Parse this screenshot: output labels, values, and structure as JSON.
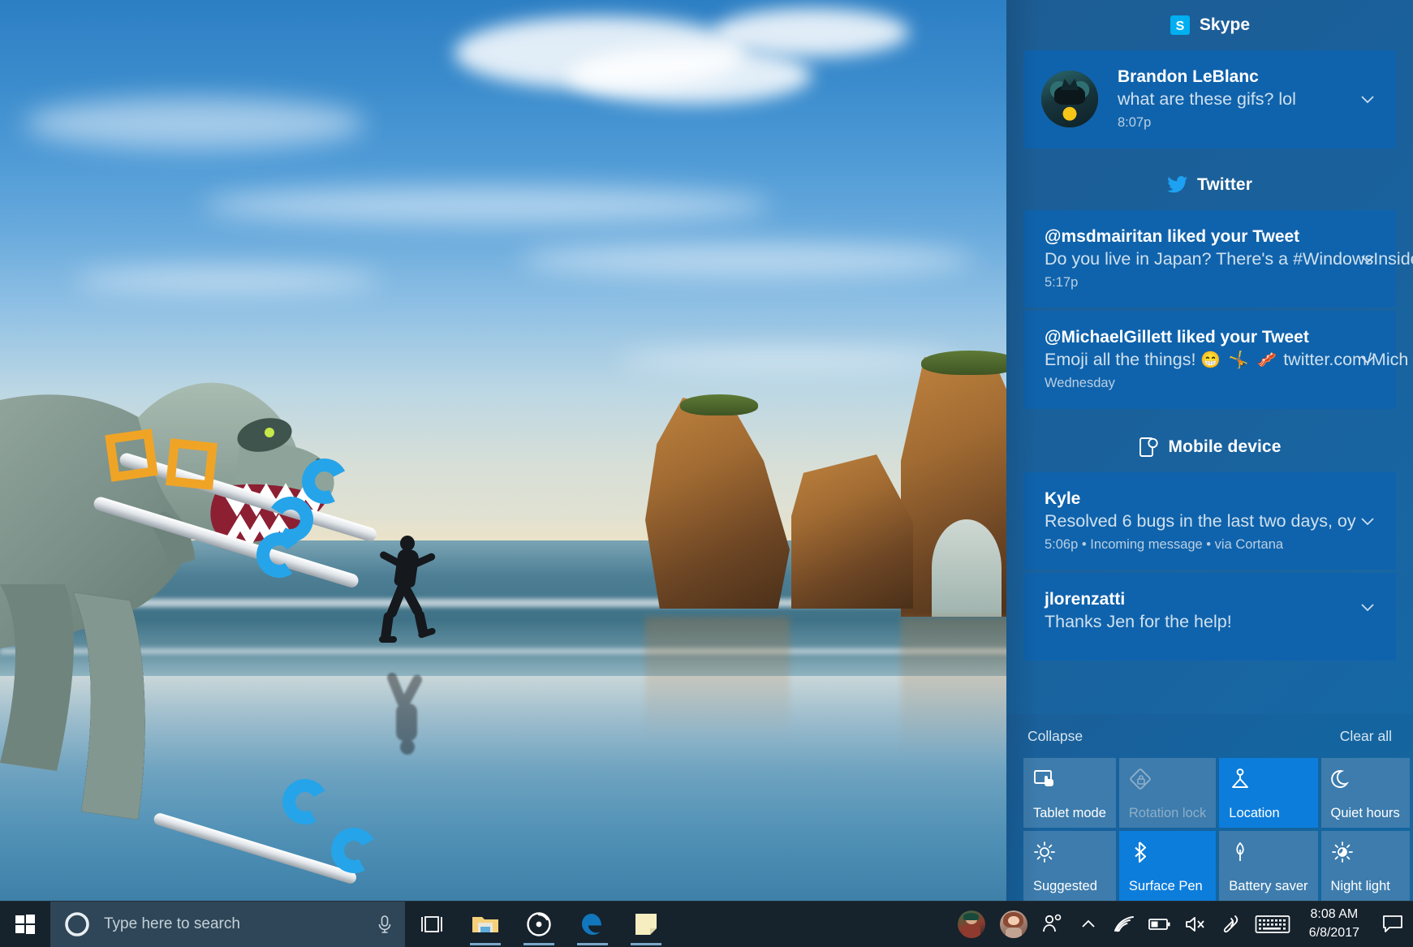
{
  "desktop": {
    "wallpaper_name": "beach-runner-wallpaper",
    "sticker_name": "3d-dinosaur-paint-object"
  },
  "action_center": {
    "groups": [
      {
        "name": "skype",
        "icon": "skype-icon",
        "label": "Skype",
        "notifications": [
          {
            "avatar": "batman-avatar",
            "title": "Brandon LeBlanc",
            "body": "what are these gifs? lol",
            "meta": "8:07p",
            "expand_icon": "chevron-down-icon"
          }
        ]
      },
      {
        "name": "twitter",
        "icon": "twitter-icon",
        "label": "Twitter",
        "notifications": [
          {
            "title": "@msdmairitan liked your Tweet",
            "body": "Do you live in Japan? There's a #WindowsInside",
            "meta": "5:17p",
            "expand_icon": "chevron-down-icon"
          },
          {
            "title": "@MichaelGillett liked your Tweet",
            "body_pre": "Emoji all the things! ",
            "body_emoji": "😁 🤸 🥓",
            "body_post": " twitter.com/Mich",
            "meta": "Wednesday",
            "expand_icon": "chevron-down-icon"
          }
        ]
      },
      {
        "name": "mobile-device",
        "icon": "mobile-device-icon",
        "label": "Mobile device",
        "notifications": [
          {
            "title": "Kyle",
            "body": "Resolved 6 bugs in the last two days, oy",
            "meta": "5:06p • Incoming message • via Cortana",
            "expand_icon": "chevron-down-icon"
          },
          {
            "title": "jlorenzatti",
            "body": "Thanks Jen for the help!",
            "meta": "",
            "expand_icon": "chevron-down-icon"
          }
        ]
      }
    ],
    "links": {
      "collapse": "Collapse",
      "clear_all": "Clear all"
    },
    "quick_actions": [
      {
        "label": "Tablet mode",
        "icon": "tablet-mode-icon",
        "state": "off"
      },
      {
        "label": "Rotation lock",
        "icon": "rotation-lock-icon",
        "state": "disabled"
      },
      {
        "label": "Location",
        "icon": "location-icon",
        "state": "on"
      },
      {
        "label": "Quiet hours",
        "icon": "moon-icon",
        "state": "off"
      },
      {
        "label": "Suggested",
        "icon": "brightness-icon",
        "state": "off"
      },
      {
        "label": "Surface Pen",
        "icon": "bluetooth-icon",
        "state": "on"
      },
      {
        "label": "Battery saver",
        "icon": "leaf-icon",
        "state": "off"
      },
      {
        "label": "Night light",
        "icon": "night-light-icon",
        "state": "off"
      }
    ],
    "colors": {
      "panel_bg": "#19639f",
      "card_bg": "#0f63ac",
      "tile_off": "#3d7cad",
      "tile_on": "#0d7ddb",
      "accent": "#0d7ddb"
    }
  },
  "taskbar": {
    "start_button": "start-button",
    "search": {
      "cortana_icon": "cortana-circle-icon",
      "placeholder": "Type here to search",
      "mic_icon": "microphone-icon"
    },
    "task_view_icon": "task-view-icon",
    "apps": [
      {
        "name": "file-explorer",
        "icon": "folder-icon"
      },
      {
        "name": "groove-music",
        "icon": "groove-music-icon"
      },
      {
        "name": "microsoft-edge",
        "icon": "edge-icon"
      },
      {
        "name": "sticky-notes",
        "icon": "sticky-note-icon"
      }
    ],
    "tray": {
      "people": [
        {
          "name": "contact-avatar-1"
        },
        {
          "name": "contact-avatar-2"
        }
      ],
      "my_people_icon": "my-people-icon",
      "show_hidden_icon": "chevron-up-icon",
      "network_icon": "wifi-icon",
      "battery_icon": "battery-icon",
      "volume_icon": "volume-muted-icon",
      "pen_icon": "surface-pen-icon",
      "keyboard_icon": "touch-keyboard-icon",
      "action_center_icon": "action-center-icon"
    },
    "clock": {
      "time": "8:08 AM",
      "date": "6/8/2017"
    }
  }
}
